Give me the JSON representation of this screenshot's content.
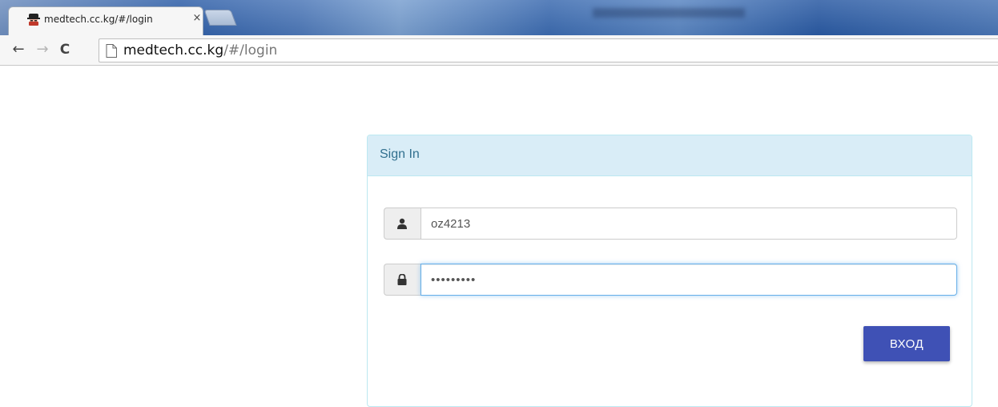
{
  "browser": {
    "tab": {
      "title": "medtech.cc.kg/#/login",
      "close_glyph": "×",
      "favicon": "spy-hat-icon"
    },
    "nav": {
      "back_glyph": "←",
      "forward_glyph": "→",
      "reload_glyph": "C"
    },
    "address": {
      "host": "medtech.cc.kg",
      "path": "/#/login",
      "page_icon": "page-icon"
    }
  },
  "login": {
    "heading": "Sign In",
    "username": {
      "value": "oz4213",
      "icon": "user-icon"
    },
    "password": {
      "value": "•••••••••",
      "icon": "lock-icon"
    },
    "submit_label": "ВХОД"
  },
  "colors": {
    "panel_heading_bg": "#d9edf7",
    "panel_border": "#bce8f1",
    "panel_title": "#31708f",
    "button_bg": "#3f51b5",
    "focus_border": "#66afe9"
  }
}
